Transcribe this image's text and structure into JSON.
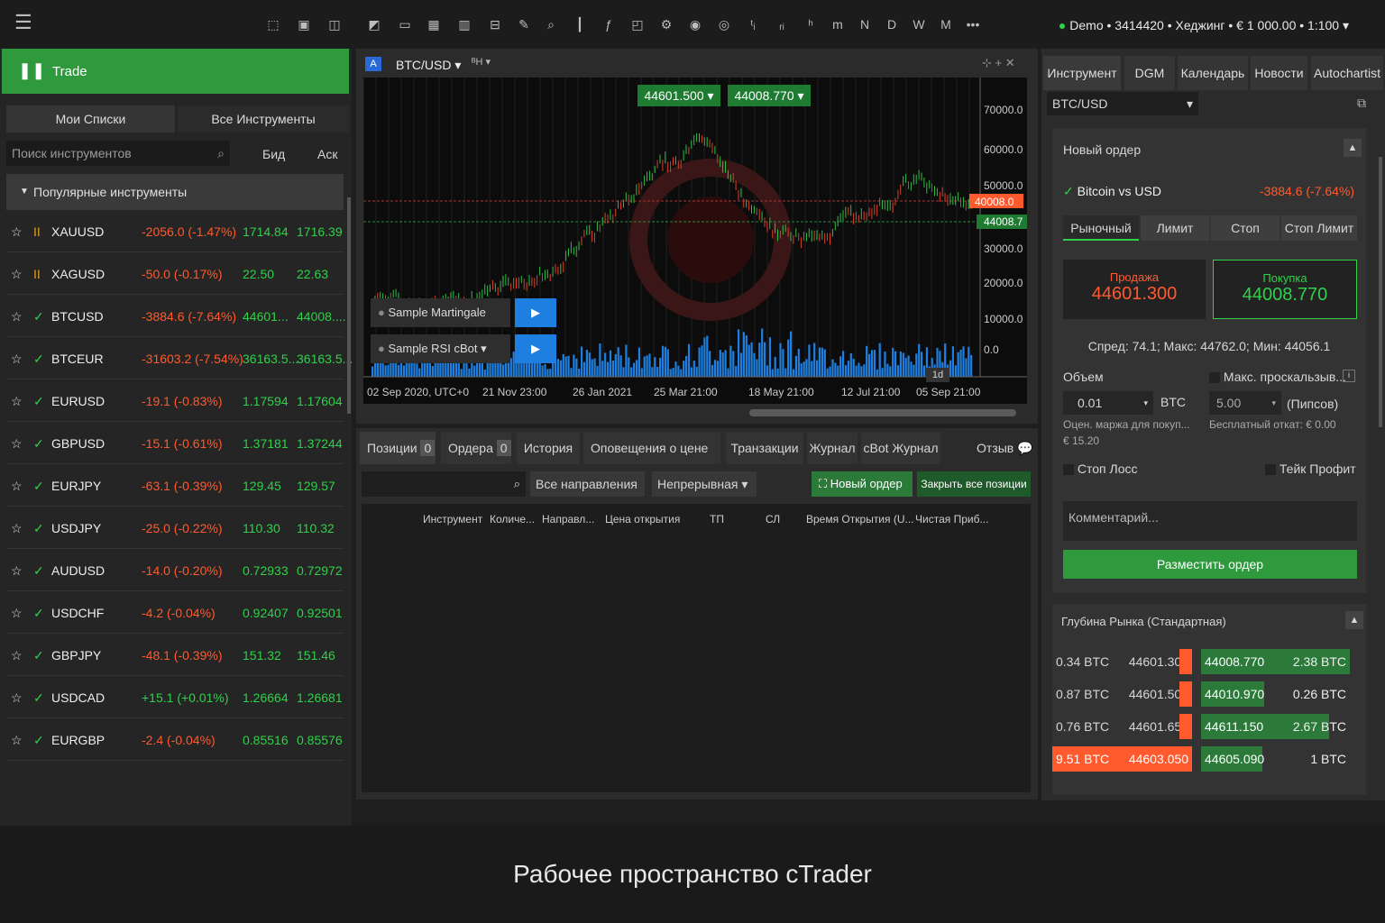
{
  "account": "Demo • 3414420 • Хеджинг • € 1 000.00 • 1:100",
  "trade_label": "Trade",
  "left_tabs": [
    "Мои Списки",
    "Все Инструменты"
  ],
  "search_placeholder": "Поиск инструментов",
  "col_bid": "Бид",
  "col_ask": "Аск",
  "popular": "Популярные инструменты",
  "rows": [
    {
      "sym": "XAUUSD",
      "chg": "-2056.0 (-1.47%)",
      "bid": "1714.84",
      "ask": "1716.39",
      "status": "paused"
    },
    {
      "sym": "XAGUSD",
      "chg": "-50.0 (-0.17%)",
      "bid": "22.50",
      "ask": "22.63",
      "status": "paused"
    },
    {
      "sym": "BTCUSD",
      "chg": "-3884.6 (-7.64%)",
      "bid": "44601...",
      "ask": "44008....",
      "status": "ok"
    },
    {
      "sym": "BTCEUR",
      "chg": "-31603.2 (-7.54%)",
      "bid": "36163.5...",
      "ask": "36163.5...",
      "status": "ok"
    },
    {
      "sym": "EURUSD",
      "chg": "-19.1 (-0.83%)",
      "bid": "1.17594",
      "ask": "1.17604",
      "status": "ok"
    },
    {
      "sym": "GBPUSD",
      "chg": "-15.1 (-0.61%)",
      "bid": "1.37181",
      "ask": "1.37244",
      "status": "ok"
    },
    {
      "sym": "EURJPY",
      "chg": "-63.1 (-0.39%)",
      "bid": "129.45",
      "ask": "129.57",
      "status": "ok"
    },
    {
      "sym": "USDJPY",
      "chg": "-25.0 (-0.22%)",
      "bid": "110.30",
      "ask": "110.32",
      "status": "ok"
    },
    {
      "sym": "AUDUSD",
      "chg": "-14.0 (-0.20%)",
      "bid": "0.72933",
      "ask": "0.72972",
      "status": "ok"
    },
    {
      "sym": "USDCHF",
      "chg": "-4.2 (-0.04%)",
      "bid": "0.92407",
      "ask": "0.92501",
      "status": "ok"
    },
    {
      "sym": "GBPJPY",
      "chg": "-48.1 (-0.39%)",
      "bid": "151.32",
      "ask": "151.46",
      "status": "ok"
    },
    {
      "sym": "USDCAD",
      "chg": "+15.1 (+0.01%)",
      "bid": "1.26664",
      "ask": "1.26681",
      "status": "ok"
    },
    {
      "sym": "EURGBP",
      "chg": "-2.4 (-0.04%)",
      "bid": "0.85516",
      "ask": "0.85576",
      "status": "ok"
    }
  ],
  "chart": {
    "symbol": "BTC/USD",
    "sell_box": "44601.500",
    "buy_box": "44008.770",
    "price_labels": [
      "70000.0",
      "60000.0",
      "50000.0",
      "40008.0",
      "44008.7",
      "30000.0",
      "20000.0",
      "10000.0",
      "0.0"
    ],
    "dates": [
      "02 Sep 2020, UTC+0",
      "21 Nov 23:00",
      "26 Jan 2021",
      "25 Mar 21:00",
      "18 May 21:00",
      "12 Jul 21:00",
      "05 Sep 21:00"
    ],
    "bots": [
      "Sample Martingale cBot",
      "Sample RSI cBot"
    ],
    "timeframe": "1d"
  },
  "bottom_tabs": [
    "Позиции",
    "Ордера",
    "История",
    "Оповещения о цене",
    "Транзакции",
    "Журнал",
    "cBot Журнал"
  ],
  "bottom_counts": [
    "0",
    "0",
    "0"
  ],
  "feedback": "Отзыв",
  "filters": [
    "Все направления",
    "Непрерывная"
  ],
  "new_order_btn": "Новый ордер",
  "close_all_btn": "Закрыть все позиции",
  "columns": [
    "Инструмент",
    "Количе...",
    "Направл...",
    "Цена открытия",
    "ТП",
    "СЛ",
    "Время Открытия (U...",
    "Чистая Приб..."
  ],
  "right_tabs": [
    "Инструмент",
    "DGM",
    "Календарь",
    "Новости",
    "Autochartist"
  ],
  "instrument": "BTC/USD",
  "new_order_title": "Новый ордер",
  "pair_name": "Bitcoin vs USD",
  "pair_chg": "-3884.6 (-7.64%)",
  "order_types": [
    "Рыночный",
    "Лимит",
    "Стоп",
    "Стоп Лимит"
  ],
  "sell_label": "Продажа",
  "sell_price": "44601.300",
  "buy_label": "Покупка",
  "buy_price": "44008.770",
  "spread": "Спред: 74.1; Макс: 44762.0; Мин: 44056.1",
  "volume_label": "Объем",
  "max_slip": "Макс. проскальзыв...",
  "volume": "0.01",
  "volume_unit": "BTC",
  "slip": "5.00",
  "slip_unit": "(Пипсов)",
  "margin": "Оцен. маржа для покуп...",
  "margin_val": "€ 15.20",
  "rollover": "Бесплатный откат: € 0.00",
  "stop_loss": "Стоп Лосс",
  "take_profit": "Тейк Профит",
  "comment": "Комментарий...",
  "place_order": "Разместить ордер",
  "depth_title": "Глубина Рынка (Стандартная)",
  "depth": [
    {
      "bv": "0.34 BTC",
      "bp": "44601.300",
      "ap": "44008.770",
      "av": "2.38 BTC"
    },
    {
      "bv": "0.87 BTC",
      "bp": "44601.500",
      "ap": "44010.970",
      "av": "0.26 BTC"
    },
    {
      "bv": "0.76 BTC",
      "bp": "44601.650",
      "ap": "44611.150",
      "av": "2.67 BTC"
    },
    {
      "bv": "9.51 BTC",
      "bp": "44603.050",
      "ap": "44605.090",
      "av": "1 BTC"
    }
  ],
  "caption": "Рабочее пространство cTrader"
}
